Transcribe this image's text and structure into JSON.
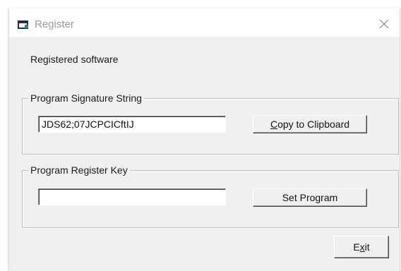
{
  "window": {
    "title": "Register",
    "icon": "app-icon",
    "close_icon": "close-icon"
  },
  "status": {
    "text": "Registered software"
  },
  "signature_group": {
    "legend": "Program Signature String",
    "value": "JDS62;07JCPCICftIJ",
    "copy_button": {
      "mnemonic": "C",
      "rest": "opy to Clipboard"
    }
  },
  "register_group": {
    "legend": "Program Register Key",
    "value": "",
    "set_button": {
      "label": "Set Program"
    }
  },
  "exit_button": {
    "before": "E",
    "mnemonic": "x",
    "after": "it"
  },
  "colors": {
    "dialog_bg": "#f0f0f0",
    "titlebar_bg": "#ffffff",
    "title_text": "#9a9a9a",
    "icon_green": "#2e8b57",
    "icon_dark": "#1f2f4f"
  }
}
